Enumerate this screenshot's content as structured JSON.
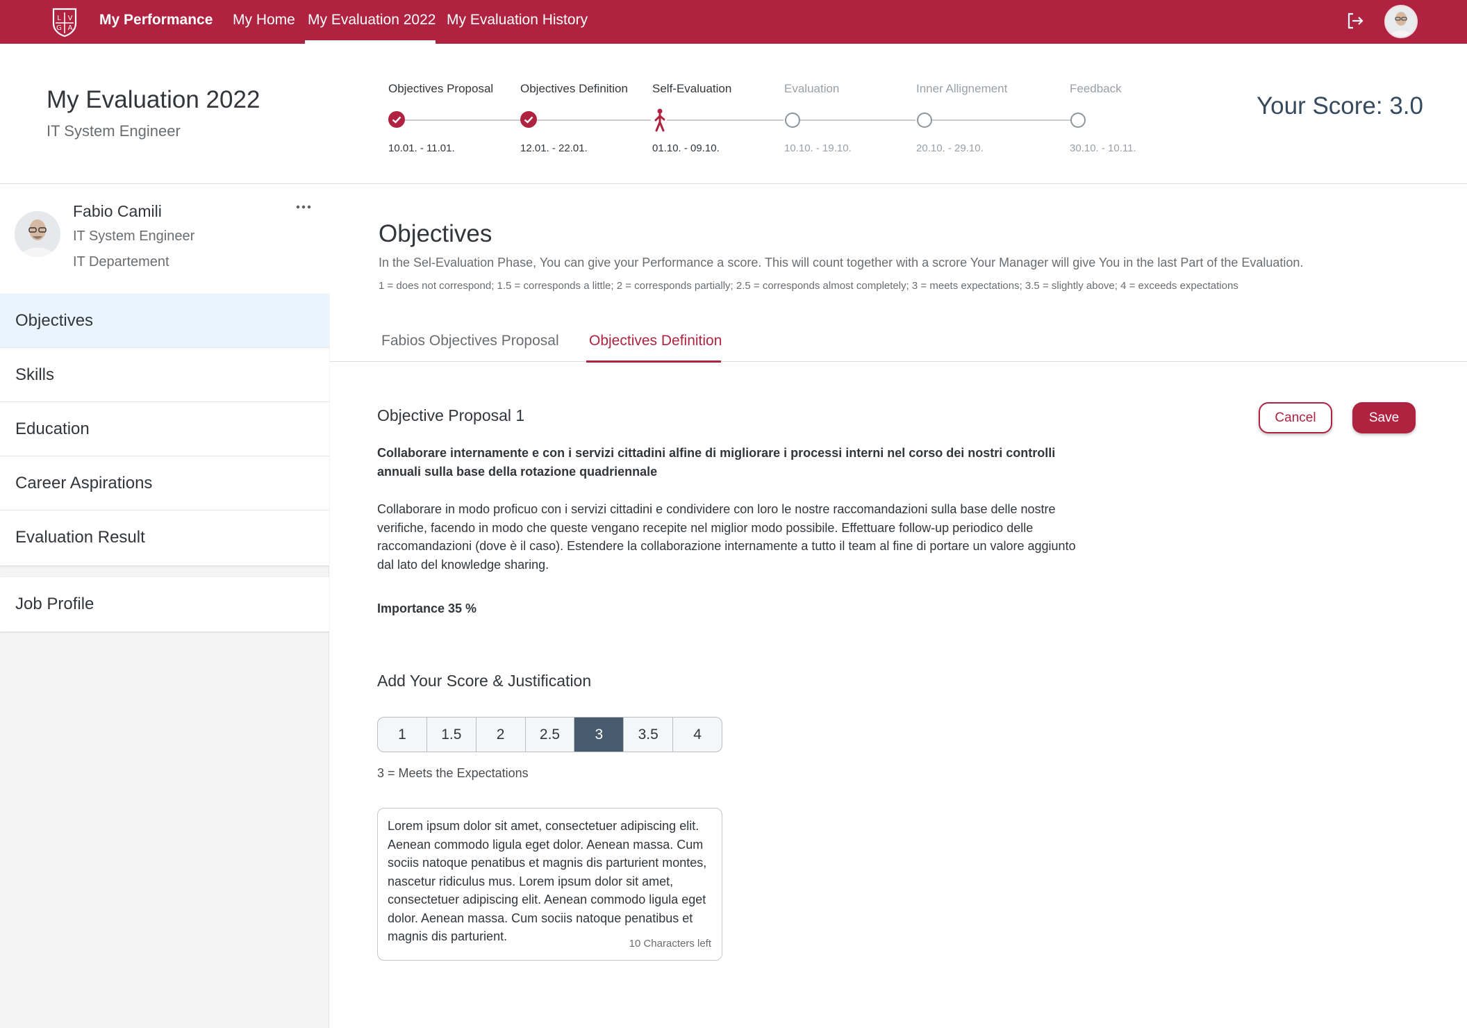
{
  "app": {
    "title": "My Performance",
    "logo": "LVGA crest logo"
  },
  "nav": {
    "links": [
      "My Home",
      "My Evaluation 2022",
      "My Evaluation History"
    ],
    "active": "My Evaluation 2022"
  },
  "header": {
    "title": "My Evaluation 2022",
    "subtitle": "IT System Engineer",
    "score": "Your Score: 3.0"
  },
  "progress": {
    "steps": [
      {
        "label": "Objectives Proposal",
        "date": "10.01. - 11.01.",
        "status": "done"
      },
      {
        "label": "Objectives Definition",
        "date": "12.01. - 22.01.",
        "status": "done"
      },
      {
        "label": "Self-Evaluation",
        "date": "01.10. - 09.10.",
        "status": "current"
      },
      {
        "label": "Evaluation",
        "date": "10.10. - 19.10.",
        "status": "future"
      },
      {
        "label": "Inner Allignement",
        "date": "20.10. - 29.10.",
        "status": "future"
      },
      {
        "label": "Feedback",
        "date": "30.10. - 10.11.",
        "status": "future"
      }
    ]
  },
  "profile": {
    "name": "Fabio Camili",
    "role": "IT System Engineer",
    "department": "IT Departement"
  },
  "sidebar": {
    "items": [
      "Objectives",
      "Skills",
      "Education",
      "Career Aspirations",
      "Evaluation Result"
    ],
    "active": "Objectives",
    "extra": "Job Profile"
  },
  "section": {
    "title": "Objectives",
    "description": "In the Sel-Evaluation Phase, You can give your Performance a score. This will count together with a scrore Your Manager will give You in the last Part of the Evaluation.",
    "legend": "1 = does not correspond; 1.5 = corresponds a little; 2 = corresponds partially; 2.5 = corresponds almost completely; 3 = meets expectations; 3.5 = slightly above; 4 = exceeds expectations"
  },
  "tabs": {
    "items": [
      "Fabios Objectives Proposal",
      "Objectives Definition"
    ],
    "active": "Objectives Definition"
  },
  "objective": {
    "title": "Objective Proposal 1",
    "heading": "Collaborare internamente e con i servizi cittadini alfine di migliorare i processi interni nel corso dei nostri controlli annuali sulla base della rotazione quadriennale",
    "text": "Collaborare in modo proficuo con i servizi cittadini e condividere con loro le nostre raccomandazioni sulla base delle nostre verifiche, facendo in modo che queste vengano recepite nel miglior modo possibile. Effettuare follow-up periodico delle raccomandazioni (dove è il caso). Estendere la collaborazione internamente a tutto il team al fine di portare un valore aggiunto dal lato del knowledge sharing.",
    "importance": "Importance 35 %"
  },
  "actions": {
    "cancel": "Cancel",
    "save": "Save"
  },
  "scoring": {
    "title": "Add Your Score & Justification",
    "options": [
      "1",
      "1.5",
      "2",
      "2.5",
      "3",
      "3.5",
      "4"
    ],
    "selected": "3",
    "caption": "3 = Meets the Expectations",
    "justification": "Lorem ipsum dolor sit amet, consectetuer adipiscing elit. Aenean commodo ligula eget dolor. Aenean massa. Cum sociis natoque penatibus et magnis dis parturient montes, nascetur ridiculus mus. Lorem ipsum dolor sit amet, consectetuer adipiscing elit. Aenean commodo ligula eget dolor. Aenean massa. Cum sociis natoque penatibus et magnis dis parturient.",
    "chars_left": "10 Characters left"
  },
  "colors": {
    "brand": "#af2341",
    "selected_segment": "#475a6e",
    "active_nav_bg": "#eaf4fc",
    "score": "#354a5f"
  },
  "icons": [
    "logo-icon",
    "logout-icon",
    "avatar",
    "more-icon",
    "check-icon",
    "walking-person-icon"
  ]
}
